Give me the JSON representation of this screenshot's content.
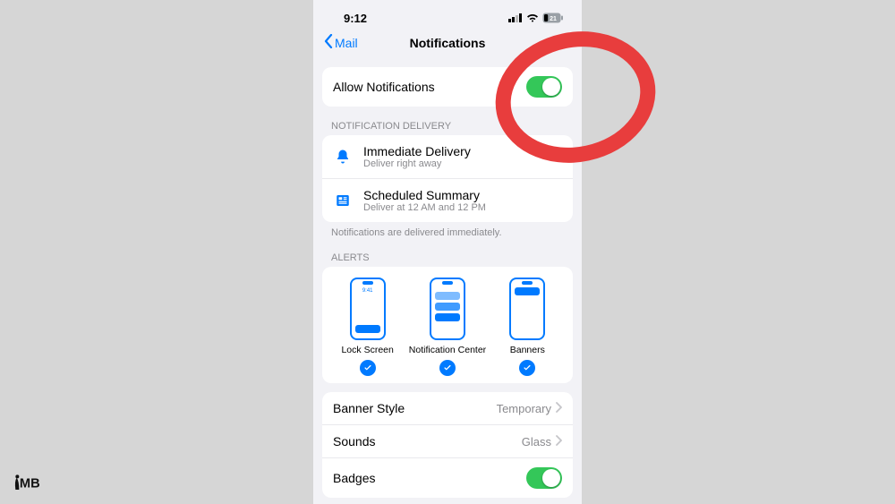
{
  "status": {
    "time": "9:12",
    "battery": "21"
  },
  "nav": {
    "back": "Mail",
    "title": "Notifications"
  },
  "allow": {
    "label": "Allow Notifications"
  },
  "delivery": {
    "header": "NOTIFICATION DELIVERY",
    "immediate": {
      "title": "Immediate Delivery",
      "sub": "Deliver right away"
    },
    "scheduled": {
      "title": "Scheduled Summary",
      "sub": "Deliver at 12 AM and 12 PM"
    },
    "footer": "Notifications are delivered immediately."
  },
  "alerts": {
    "header": "ALERTS",
    "lock": "Lock Screen",
    "center": "Notification Center",
    "banners": "Banners",
    "mock_time": "9:41"
  },
  "rows": {
    "banner_style": {
      "label": "Banner Style",
      "value": "Temporary"
    },
    "sounds": {
      "label": "Sounds",
      "value": "Glass"
    },
    "badges": {
      "label": "Badges"
    }
  },
  "logo": {
    "text": "MB"
  }
}
